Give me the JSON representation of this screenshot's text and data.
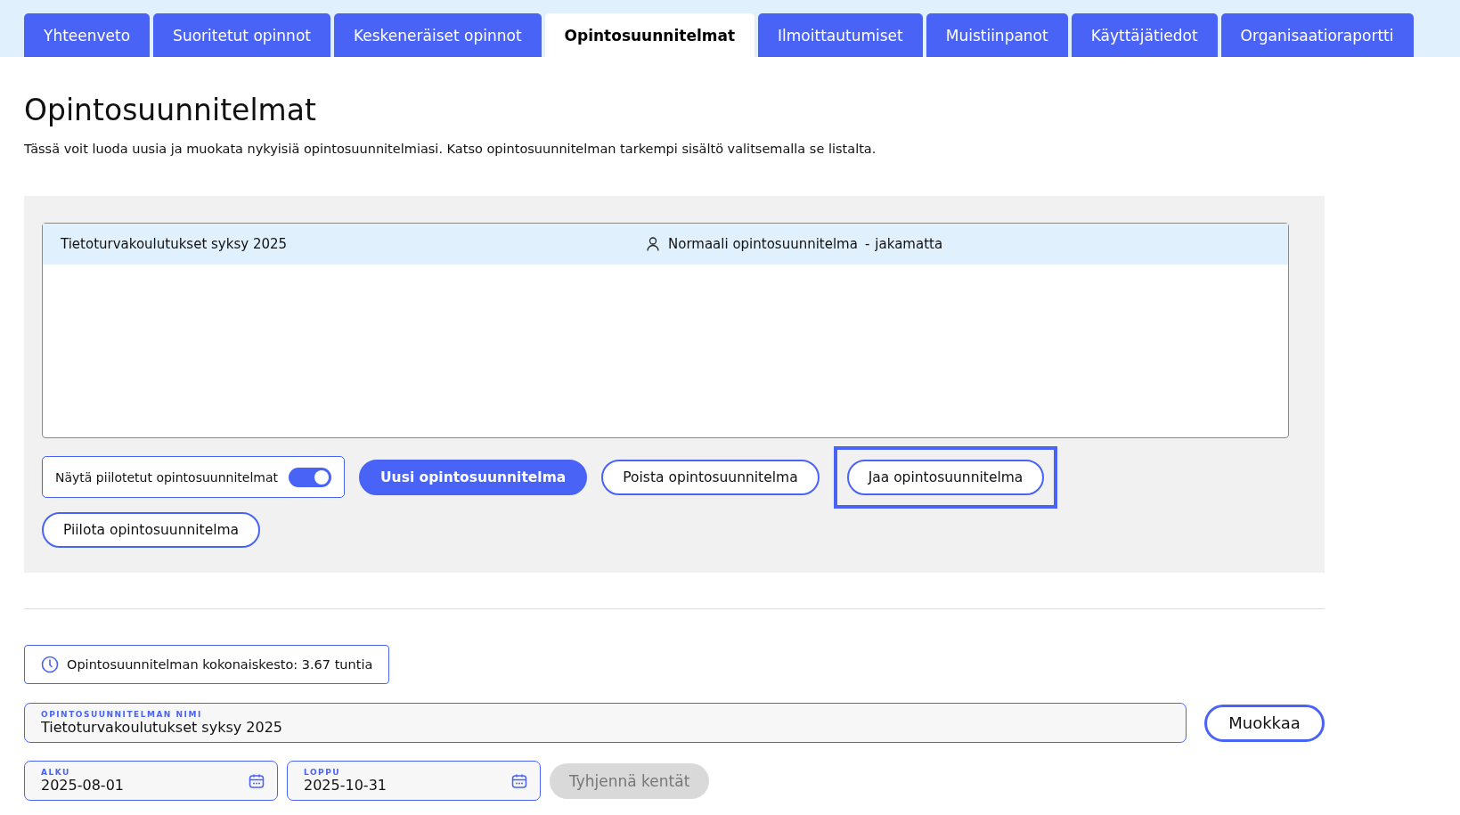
{
  "tabs": [
    {
      "label": "Yhteenveto",
      "selected": false
    },
    {
      "label": "Suoritetut opinnot",
      "selected": false
    },
    {
      "label": "Keskeneräiset opinnot",
      "selected": false
    },
    {
      "label": "Opintosuunnitelmat",
      "selected": true
    },
    {
      "label": "Ilmoittautumiset",
      "selected": false
    },
    {
      "label": "Muistiinpanot",
      "selected": false
    },
    {
      "label": "Käyttäjätiedot",
      "selected": false
    },
    {
      "label": "Organisaatioraportti",
      "selected": false
    }
  ],
  "heading": "Opintosuunnitelmat",
  "description": "Tässä voit luoda uusia ja muokata nykyisiä opintosuunnitelmiasi. Katso opintosuunnitelman tarkempi sisältö valitsemalla se listalta.",
  "plans": [
    {
      "name": "Tietoturvakoulutukset syksy 2025",
      "type": "Normaali opintosuunnitelma",
      "separator": "-",
      "sharing": "jakamatta",
      "selected": true
    }
  ],
  "toggle": {
    "label": "Näytä piilotetut opintosuunnitelmat",
    "on": true
  },
  "actions": [
    {
      "label": "Uusi opintosuunnitelma",
      "kind": "primary",
      "focused": false
    },
    {
      "label": "Poista opintosuunnitelma",
      "kind": "outline",
      "focused": false
    },
    {
      "label": "Jaa opintosuunnitelma",
      "kind": "outline",
      "focused": true
    },
    {
      "label": "Piilota opintosuunnitelma",
      "kind": "outline",
      "focused": false
    }
  ],
  "duration": "Opintosuunnitelman kokonaiskesto: 3.67 tuntia",
  "name_field": {
    "label": "OPINTOSUUNNITELMAN NIMI",
    "value": "Tietoturvakoulutukset syksy 2025"
  },
  "edit_button": "Muokkaa",
  "date_fields": [
    {
      "label": "ALKU",
      "value": "2025-08-01"
    },
    {
      "label": "LOPPU",
      "value": "2025-10-31"
    }
  ],
  "clear_button": {
    "label": "Tyhjennä kentät",
    "disabled": true
  }
}
